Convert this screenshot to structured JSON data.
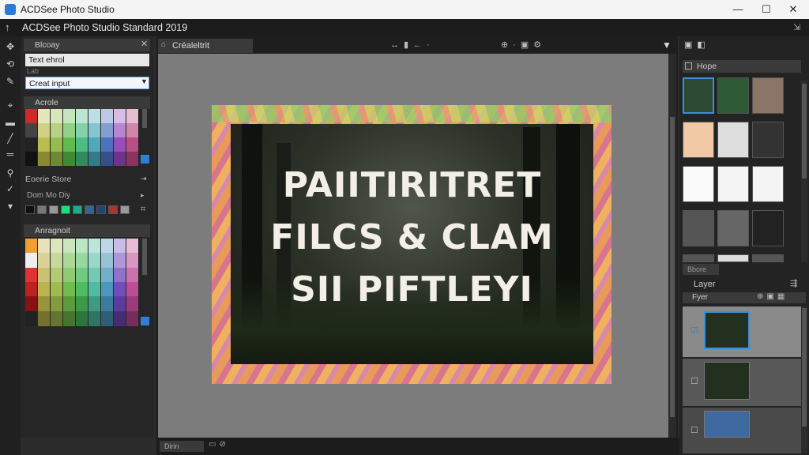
{
  "titlebar": {
    "app_name": "ACDSee Photo Studio",
    "minimize": "—",
    "maximize": "☐",
    "close": "✕"
  },
  "menubar": {
    "title": "ACDSee Photo Studio Standard 2019"
  },
  "left_panel": {
    "header": "Blcoay",
    "field1": "Text ehrol",
    "field1_sub": "Lab",
    "dropdown": "Creat input",
    "palette1_label": "Acrole",
    "section_label": "Eoerie Store",
    "row_label": "Dom  Mo  Diy",
    "palette2_label": "Anragnoit"
  },
  "document": {
    "tab_label": "Créaleltrit",
    "text_lines": [
      "PAIITIRITRET",
      "FILCS & CLAM",
      "SII PIFTLEYI"
    ]
  },
  "right_panel": {
    "header": "Hope",
    "footer_tab": "Bbore",
    "layer_section": "Layer",
    "layer_tab": "Fyer"
  },
  "statusbar": {
    "zoom": "Dirin"
  },
  "colors": {
    "accent": "#3b8fd9",
    "panel": "#262626",
    "canvas": "#7c7c7c"
  }
}
